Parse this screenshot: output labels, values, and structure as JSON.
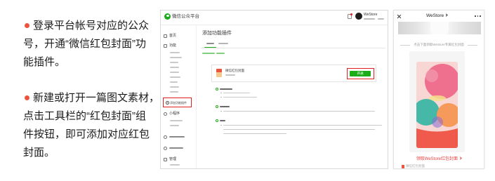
{
  "colors": {
    "bullet": "#e8553f",
    "wechat_green": "#1aad19",
    "highlight_red": "#e0201e",
    "link_red": "#e64340"
  },
  "instructions": [
    {
      "lines": [
        "登录平台帐号对应的公众",
        "号，开通“微信红包封面”功",
        "能插件。"
      ]
    },
    {
      "lines": [
        "新建或打开一篇图文素材，",
        "点击工具栏的“红包封面”组",
        "件按钮，即可添加对应红包",
        "封面。"
      ]
    }
  ],
  "mp_console": {
    "header": {
      "brand": "微信公众平台",
      "logo_icon": "wechat-logo-icon",
      "account_name": "WeStore"
    },
    "sidebar": {
      "home": {
        "label": "首页",
        "icon": "home-icon"
      },
      "features": {
        "label": "功能",
        "icon": "grid-icon"
      },
      "add_plugin": {
        "label": "添加功能插件",
        "icon": "plus-circle-icon"
      },
      "mini_program": {
        "label": "小程序",
        "icon": "mini-program-icon"
      },
      "manage": {
        "label": "管理",
        "icon": "manage-icon"
      }
    },
    "main": {
      "title": "添加功能插件",
      "plugin_card": {
        "name": "微信红包封面",
        "icon": "red-packet-icon",
        "action_label": "开通"
      }
    }
  },
  "phone": {
    "nav": {
      "title": "WeStore"
    },
    "prompt": "点击下面领取WeStore专属红包封面",
    "claim_link": "领取WeStore红包封面",
    "footer": "微信红包封面"
  }
}
